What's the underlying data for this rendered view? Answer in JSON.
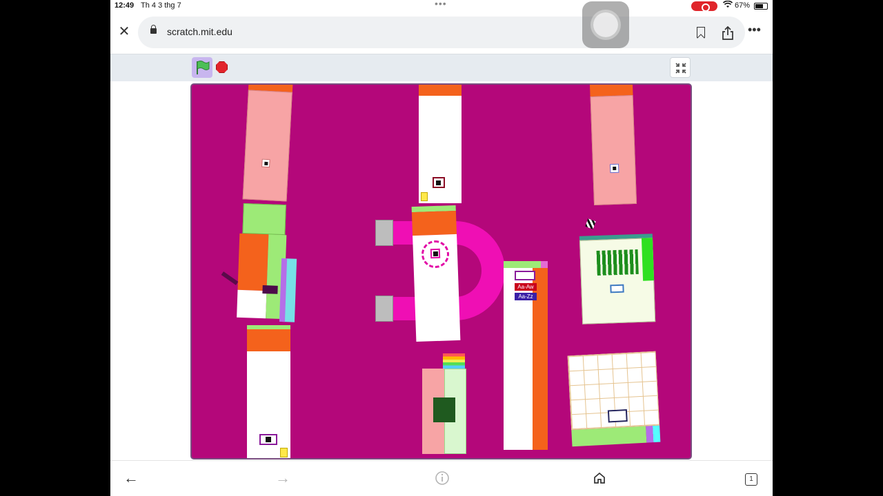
{
  "status_bar": {
    "time": "12:49",
    "date": "Th 4 3 thg 7",
    "battery": "67%",
    "battery_level": 0.67
  },
  "browser": {
    "url": "scratch.mit.edu",
    "tab_count": "1"
  },
  "icons": {
    "close": "close-icon",
    "lock": "lock-icon",
    "bookmark": "bookmark-icon",
    "share": "share-icon",
    "more": "more-icon",
    "green_flag": "green-flag-icon",
    "stop": "stop-icon",
    "fullscreen_exit": "exit-fullscreen-icon",
    "back": "back-arrow-icon",
    "forward": "forward-arrow-icon",
    "reader": "reader-info-icon",
    "home": "home-icon",
    "tabs": "tabs-icon"
  },
  "stage": {
    "background_color": "#b4077a",
    "labels": {
      "lowercase_label": "Aa-Aw",
      "range_label": "Aa-Zz"
    }
  },
  "colors": {
    "accent_flag": "#4cbf56",
    "stop_red": "#e2242c",
    "orange": "#f4621c",
    "salmon": "#f7a4a5",
    "magenta": "#ef0fb4"
  }
}
